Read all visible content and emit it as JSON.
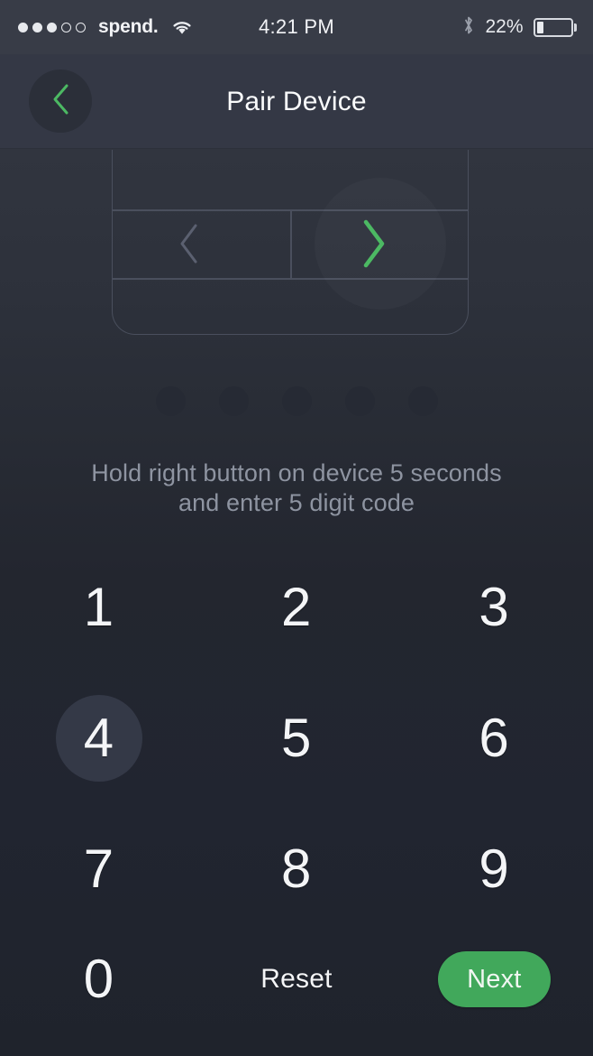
{
  "status_bar": {
    "signal_dots_total": 5,
    "signal_dots_filled": 3,
    "carrier": "spend.",
    "wifi_icon": "wifi-icon",
    "time": "4:21 PM",
    "bluetooth_icon": "bluetooth-icon",
    "battery_percent_label": "22%",
    "battery_level": 22
  },
  "nav_bar": {
    "back_icon": "chevron-left-icon",
    "title": "Pair Device"
  },
  "device_illustration": {
    "left_button_icon": "chevron-left-icon",
    "right_button_icon": "chevron-right-icon",
    "highlighted_button": "right"
  },
  "pin": {
    "length": 5,
    "entered": 0
  },
  "instruction": {
    "line1": "Hold right button  on device 5 seconds",
    "line2": "and enter 5 digit code"
  },
  "keypad": {
    "rows": [
      [
        {
          "label": "1",
          "type": "digit",
          "pressed": false
        },
        {
          "label": "2",
          "type": "digit",
          "pressed": false
        },
        {
          "label": "3",
          "type": "digit",
          "pressed": false
        }
      ],
      [
        {
          "label": "4",
          "type": "digit",
          "pressed": true
        },
        {
          "label": "5",
          "type": "digit",
          "pressed": false
        },
        {
          "label": "6",
          "type": "digit",
          "pressed": false
        }
      ],
      [
        {
          "label": "7",
          "type": "digit",
          "pressed": false
        },
        {
          "label": "8",
          "type": "digit",
          "pressed": false
        },
        {
          "label": "9",
          "type": "digit",
          "pressed": false
        }
      ],
      [
        {
          "label": "0",
          "type": "digit",
          "pressed": false
        },
        {
          "label": "Reset",
          "type": "action",
          "pressed": false
        },
        {
          "label": "Next",
          "type": "primary",
          "pressed": false
        }
      ]
    ]
  },
  "colors": {
    "accent_green": "#41a85b",
    "chevron_green": "#4cb963",
    "background_top": "#323641",
    "background_bottom": "#1f232c",
    "status_bar": "#383c47",
    "nav_bar": "#343845",
    "text_primary": "#f4f5f7",
    "text_muted": "#8e94a1",
    "device_outline": "#4a4f5d",
    "pin_dot": "#262a34",
    "key_pressed": "#343947"
  }
}
